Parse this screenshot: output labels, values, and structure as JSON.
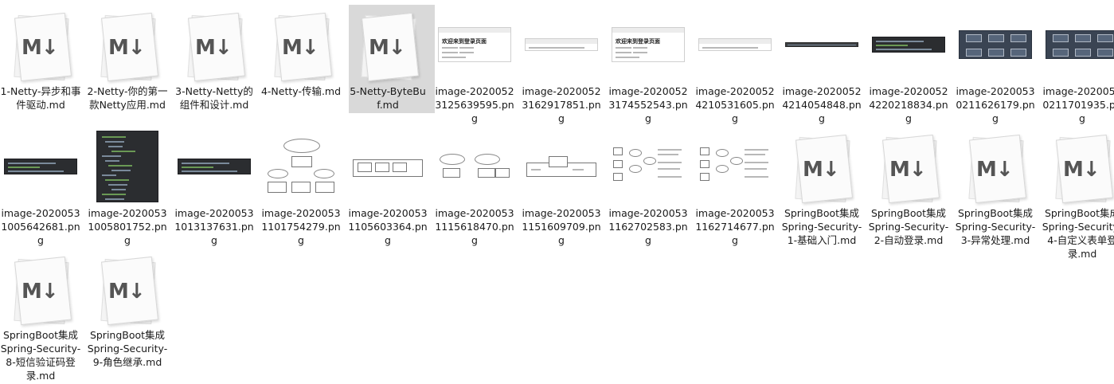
{
  "files": [
    {
      "name": "1-Netty-异步和事件驱动.md",
      "type": "md"
    },
    {
      "name": "2-Netty-你的第一款Netty应用.md",
      "type": "md"
    },
    {
      "name": "3-Netty-Netty的组件和设计.md",
      "type": "md"
    },
    {
      "name": "4-Netty-传输.md",
      "type": "md"
    },
    {
      "name": "5-Netty-ByteBuf.md",
      "type": "md",
      "selected": true
    },
    {
      "name": "image-20200523125639595.png",
      "type": "png",
      "thumb": "login",
      "thumb_title": "欢迎来到登录页面"
    },
    {
      "name": "image-20200523162917851.png",
      "type": "png",
      "thumb": "strip"
    },
    {
      "name": "image-20200523174552543.png",
      "type": "png",
      "thumb": "login",
      "thumb_title": "欢迎来到登录页面"
    },
    {
      "name": "image-20200524210531605.png",
      "type": "png",
      "thumb": "strip"
    },
    {
      "name": "image-20200524214054848.png",
      "type": "png",
      "thumb": "thinbar"
    },
    {
      "name": "image-20200524220218834.png",
      "type": "png",
      "thumb": "darkstrip"
    },
    {
      "name": "image-20200530211626179.png",
      "type": "png",
      "thumb": "darkdiagram"
    },
    {
      "name": "image-20200530211701935.png",
      "type": "png",
      "thumb": "darkdiagram"
    },
    {
      "name": "image-20200531005642681.png",
      "type": "png",
      "thumb": "darkstrip"
    },
    {
      "name": "image-20200531005801752.png",
      "type": "png",
      "thumb": "ide"
    },
    {
      "name": "image-20200531013137631.png",
      "type": "png",
      "thumb": "darkstrip"
    },
    {
      "name": "image-20200531101754279.png",
      "type": "png",
      "thumb": "flow"
    },
    {
      "name": "image-20200531105603364.png",
      "type": "png",
      "thumb": "blocks"
    },
    {
      "name": "image-20200531115618470.png",
      "type": "png",
      "thumb": "flow2"
    },
    {
      "name": "image-20200531151609709.png",
      "type": "png",
      "thumb": "blocks2"
    },
    {
      "name": "image-20200531162702583.png",
      "type": "png",
      "thumb": "seq"
    },
    {
      "name": "image-20200531162714677.png",
      "type": "png",
      "thumb": "seq"
    },
    {
      "name": "SpringBoot集成Spring-Security-1-基础入门.md",
      "type": "md"
    },
    {
      "name": "SpringBoot集成Spring-Security-2-自动登录.md",
      "type": "md"
    },
    {
      "name": "SpringBoot集成Spring-Security-3-异常处理.md",
      "type": "md"
    },
    {
      "name": "SpringBoot集成Spring-Security-4-自定义表单登录.md",
      "type": "md"
    },
    {
      "name": "SpringBoot集成Spring-Security-8-短信验证码登录.md",
      "type": "md"
    },
    {
      "name": "SpringBoot集成Spring-Security-9-角色继承.md",
      "type": "md"
    }
  ],
  "md_icon_mark": "M↓",
  "colors": {
    "selection": "#d9d9d9",
    "text": "#1a1a1a",
    "md_mark": "#555555"
  }
}
